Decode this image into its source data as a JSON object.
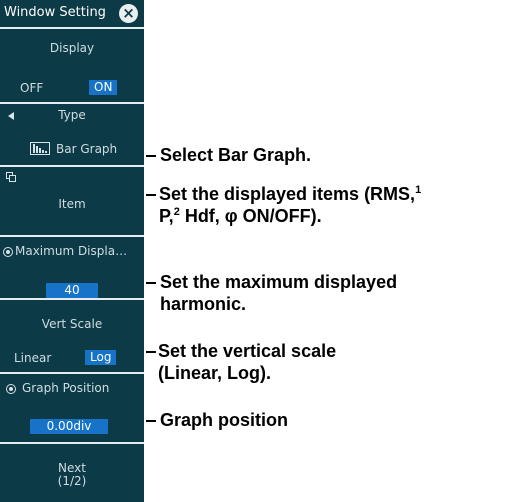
{
  "panel": {
    "title": "Window Setting",
    "close_icon": "close-icon",
    "display": {
      "label": "Display",
      "off_label": "OFF",
      "on_label": "ON",
      "selected": "ON"
    },
    "type": {
      "label": "Type",
      "value": "Bar Graph",
      "arrow_icon": "arrow-left-icon",
      "bar_icon": "bar-graph-icon"
    },
    "item": {
      "label": "Item",
      "corner_icon": "submenu-icon"
    },
    "max_display": {
      "label": "Maximum Displa…",
      "value": "40",
      "radio_icon": "radio-icon"
    },
    "vert_scale": {
      "label": "Vert Scale",
      "linear_label": "Linear",
      "log_label": "Log",
      "selected": "Log"
    },
    "graph_position": {
      "label": "Graph Position",
      "value": "0.00div",
      "radio_icon": "radio-icon"
    },
    "next": {
      "label": "Next",
      "page": "(1/2)"
    }
  },
  "annotations": {
    "type": "Select Bar Graph.",
    "item_line1": "Set the displayed items (RMS,",
    "item_sup1": "1",
    "item_line2_a": "P,",
    "item_sup2": "2",
    "item_line2_b": " Hdf, φ ON/OFF).",
    "max_line1": "Set the maximum displayed",
    "max_line2": "harmonic.",
    "scale_line1": "Set the vertical scale",
    "scale_line2": "(Linear, Log).",
    "position": "Graph position"
  },
  "colors": {
    "panel_bg": "#0c3a46",
    "selected_bg": "#1673c7",
    "separator": "#e6edf0"
  }
}
